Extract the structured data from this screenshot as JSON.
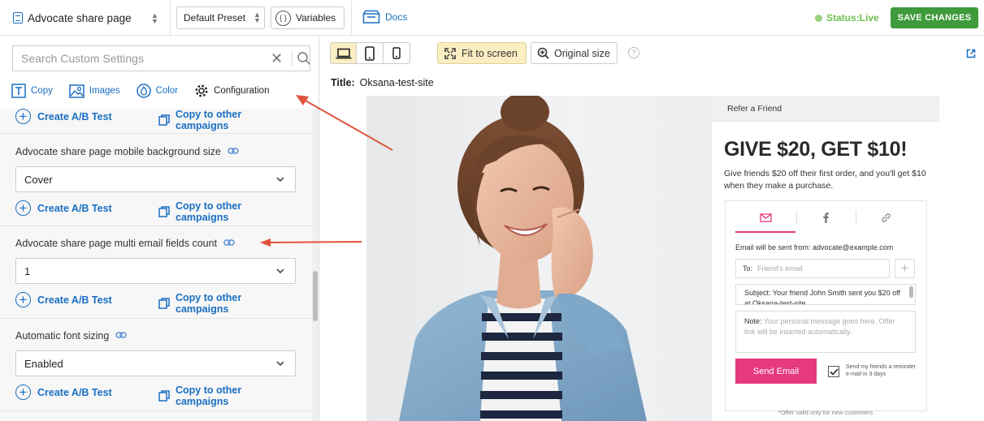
{
  "topbar": {
    "campaign_name": "Advocate share page",
    "preset_label": "Default Preset",
    "variables_label": "Variables",
    "variables_icon_glyph": "{ }",
    "docs_label": "Docs",
    "status_label": "Status:Live",
    "save_label": "SAVE CHANGES"
  },
  "sidebar": {
    "search_placeholder": "Search Custom Settings",
    "tabs": [
      {
        "label": "Copy"
      },
      {
        "label": "Images"
      },
      {
        "label": "Color"
      },
      {
        "label": "Configuration"
      }
    ],
    "create_ab_label": "Create A/B Test",
    "copy_campaigns_label": "Copy to other campaigns",
    "settings": [
      {
        "label": "Advocate share page mobile background size",
        "value": "Cover"
      },
      {
        "label": "Advocate share page multi email fields count",
        "value": "1"
      },
      {
        "label": "Automatic font sizing",
        "value": "Enabled"
      }
    ]
  },
  "preview": {
    "fit_label": "Fit to screen",
    "original_label": "Original size",
    "help_glyph": "?",
    "title_label": "Title:",
    "title_value": "Oksana-test-site",
    "widget": {
      "header": "Refer a Friend",
      "headline": "GIVE $20, GET $10!",
      "subtext": "Give friends $20 off their first order, and you'll get $10 when they make a purchase.",
      "from_text": "Email will be sent from: advocate@example.com",
      "to_label": "To:",
      "to_placeholder": "Friend's email",
      "subject_label": "Subject:",
      "subject_value": "Your friend John Smith sent you $20 off at Oksana-test-site",
      "note_label": "Note:",
      "note_placeholder": "Your personal message goes here. Offer link will be inserted automatically.",
      "send_label": "Send Email",
      "reminder_text": "Send my friends a reminder e-mail in 3 days",
      "offer_text": "*Offer valid only for new customers"
    }
  },
  "colors": {
    "accent_blue": "#1a6fc2",
    "save_green": "#3e9a3a",
    "live_green": "#6fbf4e",
    "brand_pink": "#e6397f",
    "annotation_red": "#e0533c"
  }
}
